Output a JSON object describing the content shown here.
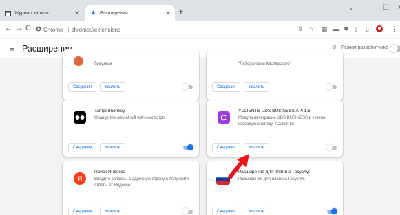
{
  "browser": {
    "tabs": [
      {
        "title": "Журнал записи",
        "active": false,
        "icon": "calendar-icon"
      },
      {
        "title": "Расширения",
        "active": true,
        "icon": "puzzle-icon"
      }
    ],
    "omnibox": {
      "scheme_label": "Chrome",
      "path": "chrome://extensions"
    }
  },
  "header": {
    "title": "Расширения",
    "dev_mode_label": "Режим разработчика",
    "dev_mode_enabled": false
  },
  "buttons": {
    "details": "Сведения",
    "remove": "Удалить"
  },
  "extensions": [
    {
      "name": "",
      "desc": "браузера",
      "enabled": false,
      "icon_color": "#e0673f"
    },
    {
      "name": "",
      "desc": "\"Лаборатории Касперского\"",
      "enabled": false,
      "icon_color": "#00a88e"
    },
    {
      "name": "Tampermonkey",
      "desc": "Change the web at will with userscripts",
      "enabled": true,
      "icon_color": "#000000"
    },
    {
      "name": "YCLIENTS UDS BUSINESS API 1.8",
      "desc": "Модуль интеграции UDS BUSINESS в учетно-кассовую систему YCLIENTS.",
      "enabled": false,
      "icon_color": "#9b3fd6"
    },
    {
      "name": "Поиск Яндекса",
      "desc": "Вводите запросы в адресную строку и получайте ответы от Яндекса",
      "enabled": false,
      "icon_color": "#fc3f1d",
      "icon_letter": "Я"
    },
    {
      "name": "Расширение для плагина Госуслуг",
      "desc": "Расширение для плагина Госуслуг.",
      "enabled": true,
      "icon_color": "#d52b1e"
    }
  ],
  "colors": {
    "accent": "#1a73e8",
    "arrow": "#e8161b"
  }
}
